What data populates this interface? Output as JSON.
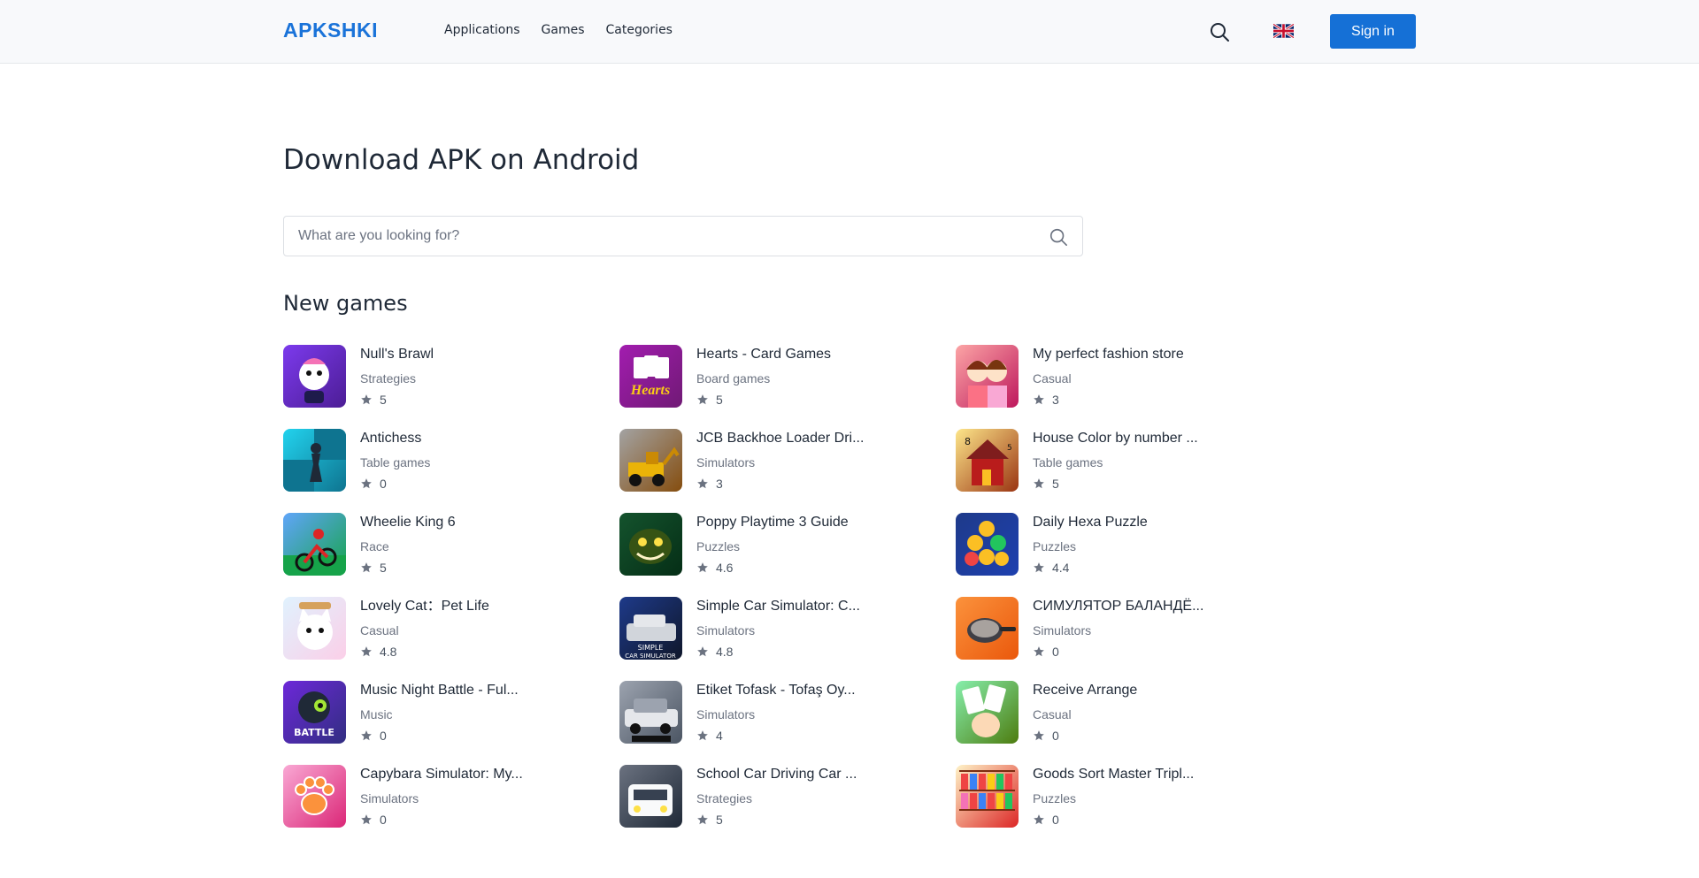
{
  "header": {
    "logo": "APKSHKI",
    "nav": [
      "Applications",
      "Games",
      "Categories"
    ],
    "signin_label": "Sign in",
    "language": "English"
  },
  "page_title": "Download APK on Android",
  "search": {
    "placeholder": "What are you looking for?"
  },
  "section_title": "New games",
  "colors": {
    "accent": "#1570d6",
    "logo": "#1a73d9",
    "star": "#6b7280"
  },
  "games": [
    {
      "name": "Null's Brawl",
      "category": "Strategies",
      "rating": "5",
      "icon": "brawler-icon",
      "bg": [
        "#7c3aed",
        "#4c1d95"
      ]
    },
    {
      "name": "Hearts - Card Games",
      "category": "Board games",
      "rating": "5",
      "icon": "hearts-cards-icon",
      "bg": [
        "#a21caf",
        "#701a75"
      ]
    },
    {
      "name": "My perfect fashion store",
      "category": "Casual",
      "rating": "3",
      "icon": "fashion-girls-icon",
      "bg": [
        "#fca5a5",
        "#be185d"
      ]
    },
    {
      "name": "Antichess",
      "category": "Table games",
      "rating": "0",
      "icon": "chess-king-icon",
      "bg": [
        "#22d3ee",
        "#0e7490"
      ]
    },
    {
      "name": "JCB Backhoe Loader Dri...",
      "category": "Simulators",
      "rating": "3",
      "icon": "backhoe-loader-icon",
      "bg": [
        "#a3a3a3",
        "#854d0e"
      ]
    },
    {
      "name": "House Color by number ...",
      "category": "Table games",
      "rating": "5",
      "icon": "house-icon",
      "bg": [
        "#fde68a",
        "#9a3412"
      ]
    },
    {
      "name": "Wheelie King 6",
      "category": "Race",
      "rating": "5",
      "icon": "motorbike-icon",
      "bg": [
        "#60a5fa",
        "#16a34a"
      ]
    },
    {
      "name": "Poppy Playtime 3 Guide",
      "category": "Puzzles",
      "rating": "4.6",
      "icon": "monster-face-icon",
      "bg": [
        "#14532d",
        "#052e16"
      ]
    },
    {
      "name": "Daily Hexa Puzzle",
      "category": "Puzzles",
      "rating": "4.4",
      "icon": "hexagon-puzzle-icon",
      "bg": [
        "#1e3a8a",
        "#1e40af"
      ]
    },
    {
      "name": "Lovely Cat：Pet Life",
      "category": "Casual",
      "rating": "4.8",
      "icon": "cat-icon",
      "bg": [
        "#e0f2fe",
        "#fbcfe8"
      ]
    },
    {
      "name": "Simple Car Simulator: C...",
      "category": "Simulators",
      "rating": "4.8",
      "icon": "car-icon",
      "bg": [
        "#1e3a8a",
        "#0f172a"
      ]
    },
    {
      "name": "СИМУЛЯТОР БАЛАНДЁ...",
      "category": "Simulators",
      "rating": "0",
      "icon": "frying-pan-icon",
      "bg": [
        "#fb923c",
        "#ea580c"
      ]
    },
    {
      "name": "Music Night Battle - Ful...",
      "category": "Music",
      "rating": "0",
      "icon": "music-battle-icon",
      "bg": [
        "#6d28d9",
        "#312e81"
      ]
    },
    {
      "name": "Etiket Tofask - Tofaş Oy...",
      "category": "Simulators",
      "rating": "4",
      "icon": "sedan-car-icon",
      "bg": [
        "#9ca3af",
        "#4b5563"
      ]
    },
    {
      "name": "Receive Arrange",
      "category": "Casual",
      "rating": "0",
      "icon": "hand-cards-icon",
      "bg": [
        "#86efac",
        "#4d7c0f"
      ]
    },
    {
      "name": "Capybara Simulator: My...",
      "category": "Simulators",
      "rating": "0",
      "icon": "paw-icon",
      "bg": [
        "#f9a8d4",
        "#db2777"
      ]
    },
    {
      "name": "School Car Driving Car ...",
      "category": "Strategies",
      "rating": "5",
      "icon": "white-car-icon",
      "bg": [
        "#6b7280",
        "#1f2937"
      ]
    },
    {
      "name": "Goods Sort Master Tripl...",
      "category": "Puzzles",
      "rating": "0",
      "icon": "shelf-goods-icon",
      "bg": [
        "#fef3c7",
        "#dc2626"
      ]
    }
  ]
}
